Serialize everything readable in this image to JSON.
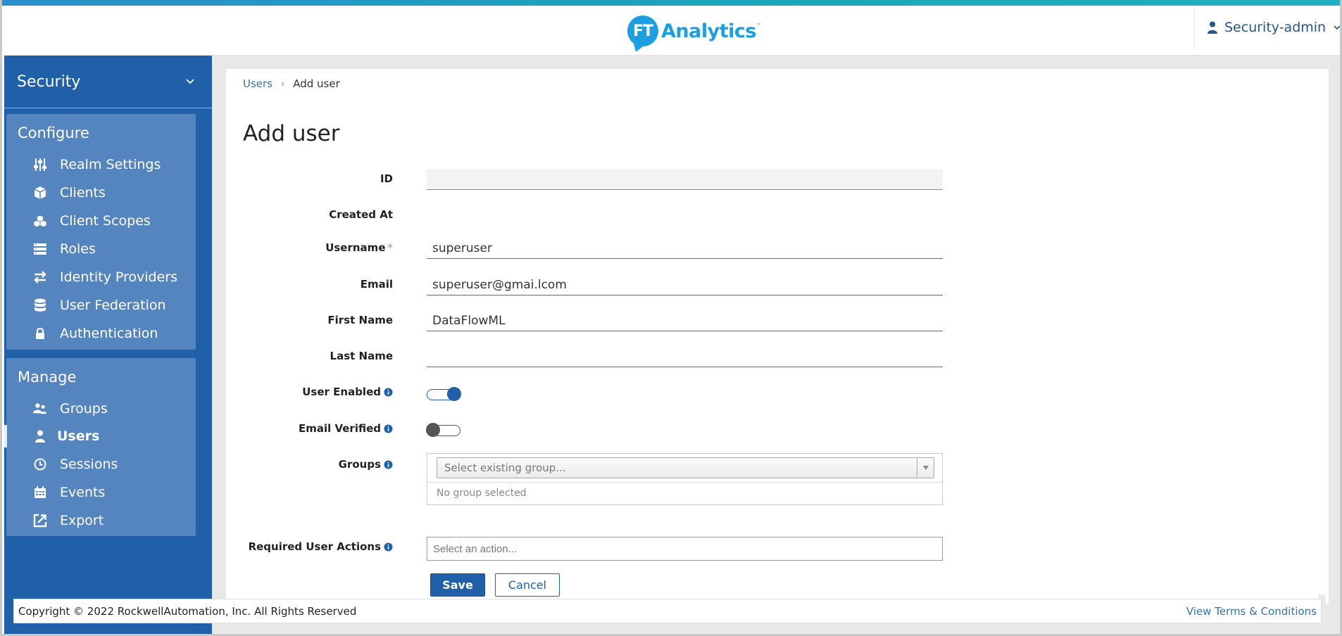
{
  "header": {
    "logo_mark": "FT",
    "logo_text": "Analytics",
    "logo_tm": "™",
    "user_label": "Security-admin"
  },
  "sidebar": {
    "realm": "Security",
    "configure_heading": "Configure",
    "configure_items": [
      {
        "label": "Realm Settings",
        "icon": "sliders-icon"
      },
      {
        "label": "Clients",
        "icon": "cube-icon"
      },
      {
        "label": "Client Scopes",
        "icon": "cubes-icon"
      },
      {
        "label": "Roles",
        "icon": "list-icon"
      },
      {
        "label": "Identity Providers",
        "icon": "exchange-icon"
      },
      {
        "label": "User Federation",
        "icon": "database-icon"
      },
      {
        "label": "Authentication",
        "icon": "lock-icon"
      }
    ],
    "manage_heading": "Manage",
    "manage_items": [
      {
        "label": "Groups",
        "icon": "users-icon"
      },
      {
        "label": "Users",
        "icon": "user-icon",
        "active": true
      },
      {
        "label": "Sessions",
        "icon": "clock-icon"
      },
      {
        "label": "Events",
        "icon": "calendar-icon"
      },
      {
        "label": "Export",
        "icon": "export-icon"
      }
    ]
  },
  "breadcrumb": {
    "parent": "Users",
    "separator": "›",
    "current": "Add user"
  },
  "page_title": "Add user",
  "form": {
    "id_label": "ID",
    "created_at_label": "Created At",
    "username_label": "Username",
    "username_required": "*",
    "username_value": "superuser",
    "email_label": "Email",
    "email_value": "superuser@gmai.lcom",
    "first_name_label": "First Name",
    "first_name_value": "DataFlowML",
    "last_name_label": "Last Name",
    "last_name_value": "",
    "user_enabled_label": "User Enabled",
    "user_enabled": true,
    "email_verified_label": "Email Verified",
    "email_verified": false,
    "groups_label": "Groups",
    "groups_placeholder": "Select existing group...",
    "groups_empty": "No group selected",
    "required_actions_label": "Required User Actions",
    "required_actions_placeholder": "Select an action...",
    "save_label": "Save",
    "cancel_label": "Cancel"
  },
  "footer": {
    "copyright": "Copyright © 2022 RockwellAutomation, Inc. All Rights Reserved",
    "terms": "View Terms & Conditions"
  },
  "colors": {
    "sidebar_bg": "#2060a8",
    "nav_panel_bg": "#5585bf",
    "brand": "#1c9fe0",
    "link": "#2f73b5"
  }
}
